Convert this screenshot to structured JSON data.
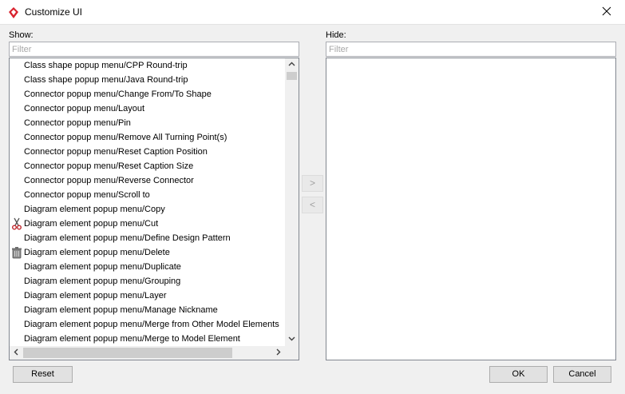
{
  "window": {
    "title": "Customize UI",
    "app_icon": "visual-paradigm-icon",
    "close_icon": "close-icon"
  },
  "show_pane": {
    "label": "Show:",
    "filter_placeholder": "Filter",
    "items": [
      {
        "label": "Class shape popup menu/CPP Round-trip",
        "icon": ""
      },
      {
        "label": "Class shape popup menu/Java Round-trip",
        "icon": ""
      },
      {
        "label": "Connector popup menu/Change From/To Shape",
        "icon": ""
      },
      {
        "label": "Connector popup menu/Layout",
        "icon": ""
      },
      {
        "label": "Connector popup menu/Pin",
        "icon": ""
      },
      {
        "label": "Connector popup menu/Remove All Turning Point(s)",
        "icon": ""
      },
      {
        "label": "Connector popup menu/Reset Caption Position",
        "icon": ""
      },
      {
        "label": "Connector popup menu/Reset Caption Size",
        "icon": ""
      },
      {
        "label": "Connector popup menu/Reverse Connector",
        "icon": ""
      },
      {
        "label": "Connector popup menu/Scroll to",
        "icon": ""
      },
      {
        "label": "Diagram element popup menu/Copy",
        "icon": ""
      },
      {
        "label": "Diagram element popup menu/Cut",
        "icon": "scissors-icon"
      },
      {
        "label": "Diagram element popup menu/Define Design Pattern",
        "icon": ""
      },
      {
        "label": "Diagram element popup menu/Delete",
        "icon": "trash-icon"
      },
      {
        "label": "Diagram element popup menu/Duplicate",
        "icon": ""
      },
      {
        "label": "Diagram element popup menu/Grouping",
        "icon": ""
      },
      {
        "label": "Diagram element popup menu/Layer",
        "icon": ""
      },
      {
        "label": "Diagram element popup menu/Manage Nickname",
        "icon": ""
      },
      {
        "label": "Diagram element popup menu/Merge from Other Model Elements",
        "icon": ""
      },
      {
        "label": "Diagram element popup menu/Merge to Model Element",
        "icon": ""
      }
    ]
  },
  "hide_pane": {
    "label": "Hide:",
    "filter_placeholder": "Filter",
    "items": []
  },
  "transfer": {
    "move_right_label": ">",
    "move_left_label": "<"
  },
  "footer": {
    "reset_label": "Reset",
    "ok_label": "OK",
    "cancel_label": "Cancel"
  },
  "colors": {
    "accent_red": "#d9232e",
    "window_bg": "#f0f0f0"
  }
}
